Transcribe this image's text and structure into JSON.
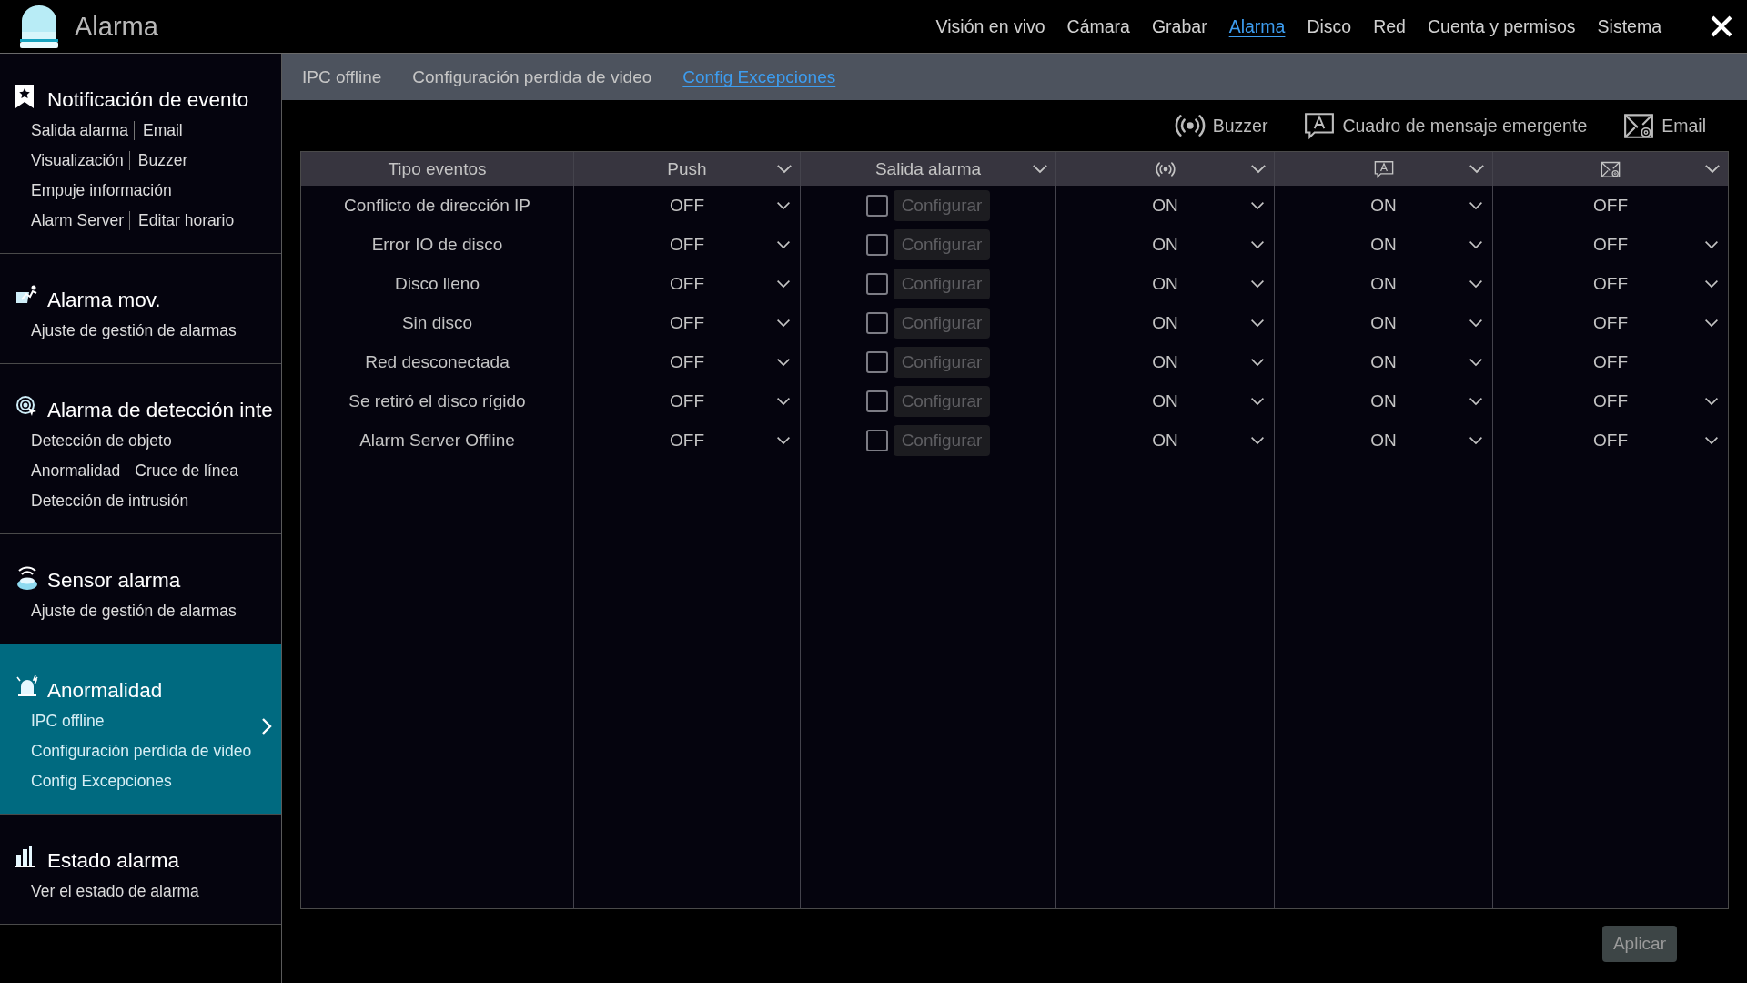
{
  "window": {
    "title": "Alarma"
  },
  "nav": [
    {
      "label": "Visión en vivo",
      "selected": false
    },
    {
      "label": "Cámara",
      "selected": false
    },
    {
      "label": "Grabar",
      "selected": false
    },
    {
      "label": "Alarma",
      "selected": true
    },
    {
      "label": "Disco",
      "selected": false
    },
    {
      "label": "Red",
      "selected": false
    },
    {
      "label": "Cuenta y permisos",
      "selected": false
    },
    {
      "label": "Sistema",
      "selected": false
    }
  ],
  "sidebar": [
    {
      "kind": "bookmark",
      "title": "Notificación de evento",
      "selected": false,
      "rows": [
        [
          "Salida alarma",
          "Email"
        ],
        [
          "Visualización",
          "Buzzer"
        ],
        [
          "Empuje información"
        ],
        [
          "Alarm Server",
          "Editar horario"
        ]
      ]
    },
    {
      "kind": "motion",
      "title": "Alarma mov.",
      "selected": false,
      "rows": [
        [
          "Ajuste de gestión de alarmas"
        ]
      ]
    },
    {
      "kind": "target",
      "title": "Alarma de detección inte",
      "selected": false,
      "rows": [
        [
          "Detección de objeto"
        ],
        [
          "Anormalidad",
          "Cruce de línea"
        ],
        [
          "Detección de intrusión"
        ]
      ]
    },
    {
      "kind": "sensor",
      "title": "Sensor alarma",
      "selected": false,
      "rows": [
        [
          "Ajuste de gestión de alarmas"
        ]
      ]
    },
    {
      "kind": "siren",
      "title": "Anormalidad",
      "selected": true,
      "rows": [
        [
          "IPC offline"
        ],
        [
          "Configuración perdida de video"
        ],
        [
          "Config Excepciones"
        ]
      ]
    },
    {
      "kind": "chart",
      "title": "Estado alarma",
      "selected": false,
      "rows": [
        [
          "Ver el estado de alarma"
        ]
      ]
    }
  ],
  "tabs": [
    {
      "label": "IPC offline",
      "selected": false
    },
    {
      "label": "Configuración perdida de video",
      "selected": false
    },
    {
      "label": "Config Excepciones",
      "selected": true
    }
  ],
  "legend": [
    {
      "kind": "buzzer",
      "label": "Buzzer"
    },
    {
      "kind": "popup",
      "label": "Cuadro de mensaje emergente"
    },
    {
      "kind": "email",
      "label": "Email"
    }
  ],
  "table": {
    "columns": [
      {
        "kind": "text",
        "label": "Tipo eventos",
        "dropdown": false
      },
      {
        "kind": "text",
        "label": "Push",
        "dropdown": true
      },
      {
        "kind": "text",
        "label": "Salida alarma",
        "dropdown": true
      },
      {
        "kind": "buzzer",
        "dropdown": true
      },
      {
        "kind": "popup",
        "dropdown": true
      },
      {
        "kind": "email",
        "dropdown": true
      }
    ],
    "rows": [
      {
        "event": "Conflicto de dirección IP",
        "push": "OFF",
        "checked": false,
        "configure": "Configurar",
        "buzzer": "ON",
        "popup": "ON",
        "email": "OFF",
        "email_dropdown": false
      },
      {
        "event": "Error IO de disco",
        "push": "OFF",
        "checked": false,
        "configure": "Configurar",
        "buzzer": "ON",
        "popup": "ON",
        "email": "OFF",
        "email_dropdown": true
      },
      {
        "event": "Disco lleno",
        "push": "OFF",
        "checked": false,
        "configure": "Configurar",
        "buzzer": "ON",
        "popup": "ON",
        "email": "OFF",
        "email_dropdown": true
      },
      {
        "event": "Sin disco",
        "push": "OFF",
        "checked": false,
        "configure": "Configurar",
        "buzzer": "ON",
        "popup": "ON",
        "email": "OFF",
        "email_dropdown": true
      },
      {
        "event": "Red desconectada",
        "push": "OFF",
        "checked": false,
        "configure": "Configurar",
        "buzzer": "ON",
        "popup": "ON",
        "email": "OFF",
        "email_dropdown": false
      },
      {
        "event": "Se retiró el disco rígido",
        "push": "OFF",
        "checked": false,
        "configure": "Configurar",
        "buzzer": "ON",
        "popup": "ON",
        "email": "OFF",
        "email_dropdown": true
      },
      {
        "event": "Alarm Server Offline",
        "push": "OFF",
        "checked": false,
        "configure": "Configurar",
        "buzzer": "ON",
        "popup": "ON",
        "email": "OFF",
        "email_dropdown": true
      }
    ]
  },
  "apply_button": "Aplicar"
}
